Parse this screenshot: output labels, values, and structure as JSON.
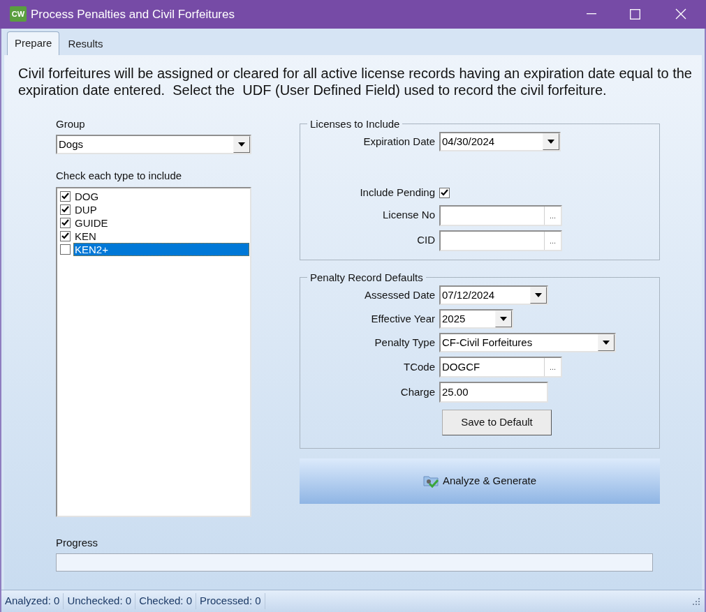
{
  "window": {
    "title": "Process Penalties and Civil Forfeitures",
    "icon_text": "CW"
  },
  "tabs": [
    {
      "label": "Prepare",
      "selected": true
    },
    {
      "label": "Results",
      "selected": false
    }
  ],
  "description": "Civil forfeitures will be assigned or cleared for all active license records having an expiration date equal to the expiration date entered.  Select the  UDF (User Defined Field) used to record the civil forfeiture.",
  "group": {
    "label": "Group",
    "value": "Dogs"
  },
  "types": {
    "label": "Check each type to include",
    "items": [
      {
        "label": "DOG",
        "checked": true,
        "selected": false
      },
      {
        "label": "DUP",
        "checked": true,
        "selected": false
      },
      {
        "label": "GUIDE",
        "checked": true,
        "selected": false
      },
      {
        "label": "KEN",
        "checked": true,
        "selected": false
      },
      {
        "label": "KEN2+",
        "checked": false,
        "selected": true
      }
    ]
  },
  "licenses": {
    "legend": "Licenses to Include",
    "fields": [
      {
        "kind": "dropdown",
        "label": "Expiration Date",
        "value": "04/30/2024"
      },
      {
        "kind": "spacer"
      },
      {
        "kind": "checkbox",
        "label": "Include Pending",
        "checked": true
      },
      {
        "kind": "lookup",
        "label": "License No",
        "button": "..."
      },
      {
        "kind": "lookup",
        "label": "CID",
        "button": "..."
      }
    ]
  },
  "penalty": {
    "legend": "Penalty Record Defaults",
    "fields": [
      {
        "kind": "dropdown",
        "label": "Assessed Date",
        "value": "07/12/2024"
      },
      {
        "kind": "dropdown",
        "label": "Effective Year",
        "value": "2025"
      },
      {
        "kind": "dropdown",
        "label": "Penalty Type",
        "value": "CF-Civil Forfeitures"
      },
      {
        "kind": "lookup",
        "label": "TCode",
        "value": "DOGCF",
        "button": "..."
      },
      {
        "kind": "text",
        "label": "Charge",
        "value": "25.00"
      }
    ],
    "button": "Save to Default"
  },
  "analyze_button": "Analyze & Generate",
  "progress": {
    "label": "Progress",
    "level": 0
  },
  "status_bar": [
    "Analyzed: 0",
    "Unchecked: 0",
    "Checked: 0",
    "Processed: 0"
  ]
}
